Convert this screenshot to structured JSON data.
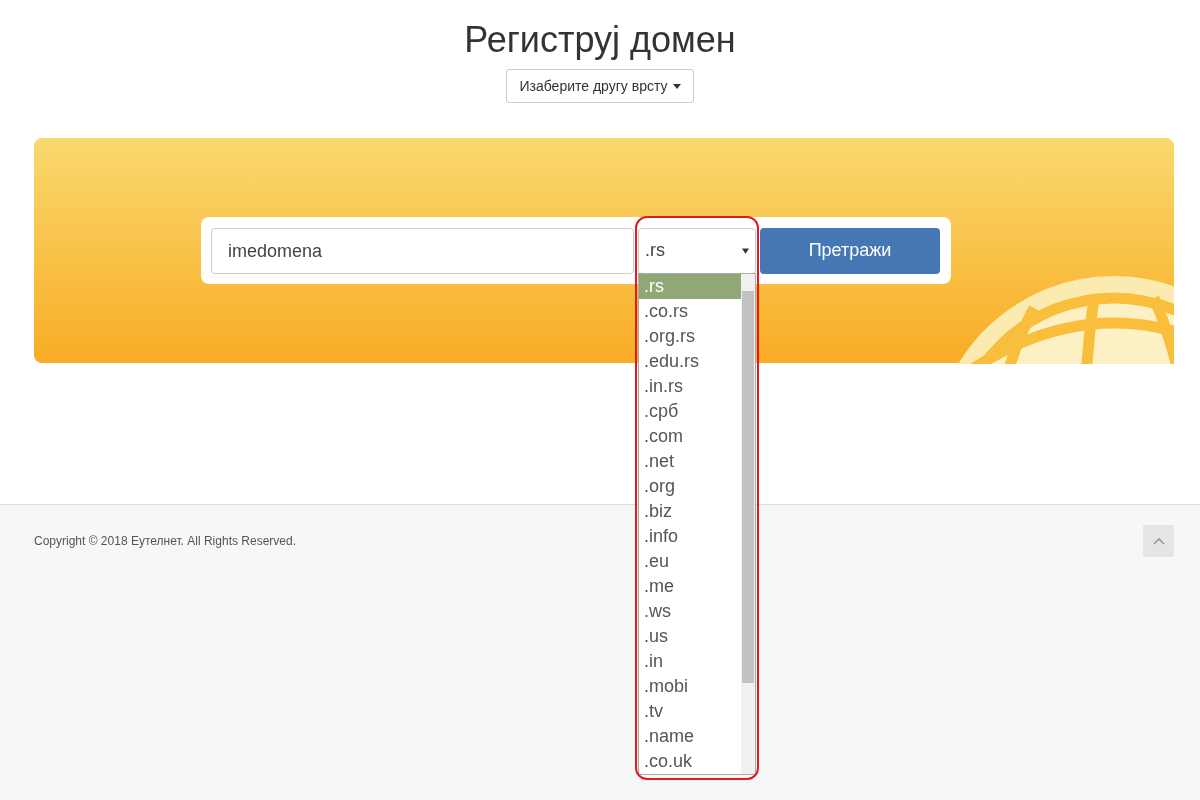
{
  "page": {
    "title": "Региструј домен"
  },
  "type_button": {
    "label": "Изаберите другу врсту"
  },
  "search": {
    "value": "imedomena",
    "extension": ".rs",
    "button": "Претражи",
    "highlighted": true
  },
  "extensions": [
    {
      "label": ".rs",
      "selected": true
    },
    {
      "label": ".co.rs",
      "selected": false
    },
    {
      "label": ".org.rs",
      "selected": false
    },
    {
      "label": ".edu.rs",
      "selected": false
    },
    {
      "label": ".in.rs",
      "selected": false
    },
    {
      "label": ".срб",
      "selected": false
    },
    {
      "label": ".com",
      "selected": false
    },
    {
      "label": ".net",
      "selected": false
    },
    {
      "label": ".org",
      "selected": false
    },
    {
      "label": ".biz",
      "selected": false
    },
    {
      "label": ".info",
      "selected": false
    },
    {
      "label": ".eu",
      "selected": false
    },
    {
      "label": ".me",
      "selected": false
    },
    {
      "label": ".ws",
      "selected": false
    },
    {
      "label": ".us",
      "selected": false
    },
    {
      "label": ".in",
      "selected": false
    },
    {
      "label": ".mobi",
      "selected": false
    },
    {
      "label": ".tv",
      "selected": false
    },
    {
      "label": ".name",
      "selected": false
    },
    {
      "label": ".co.uk",
      "selected": false
    }
  ],
  "footer": {
    "copyright": "Copyright © 2018 Еутелнет. All Rights Reserved."
  }
}
